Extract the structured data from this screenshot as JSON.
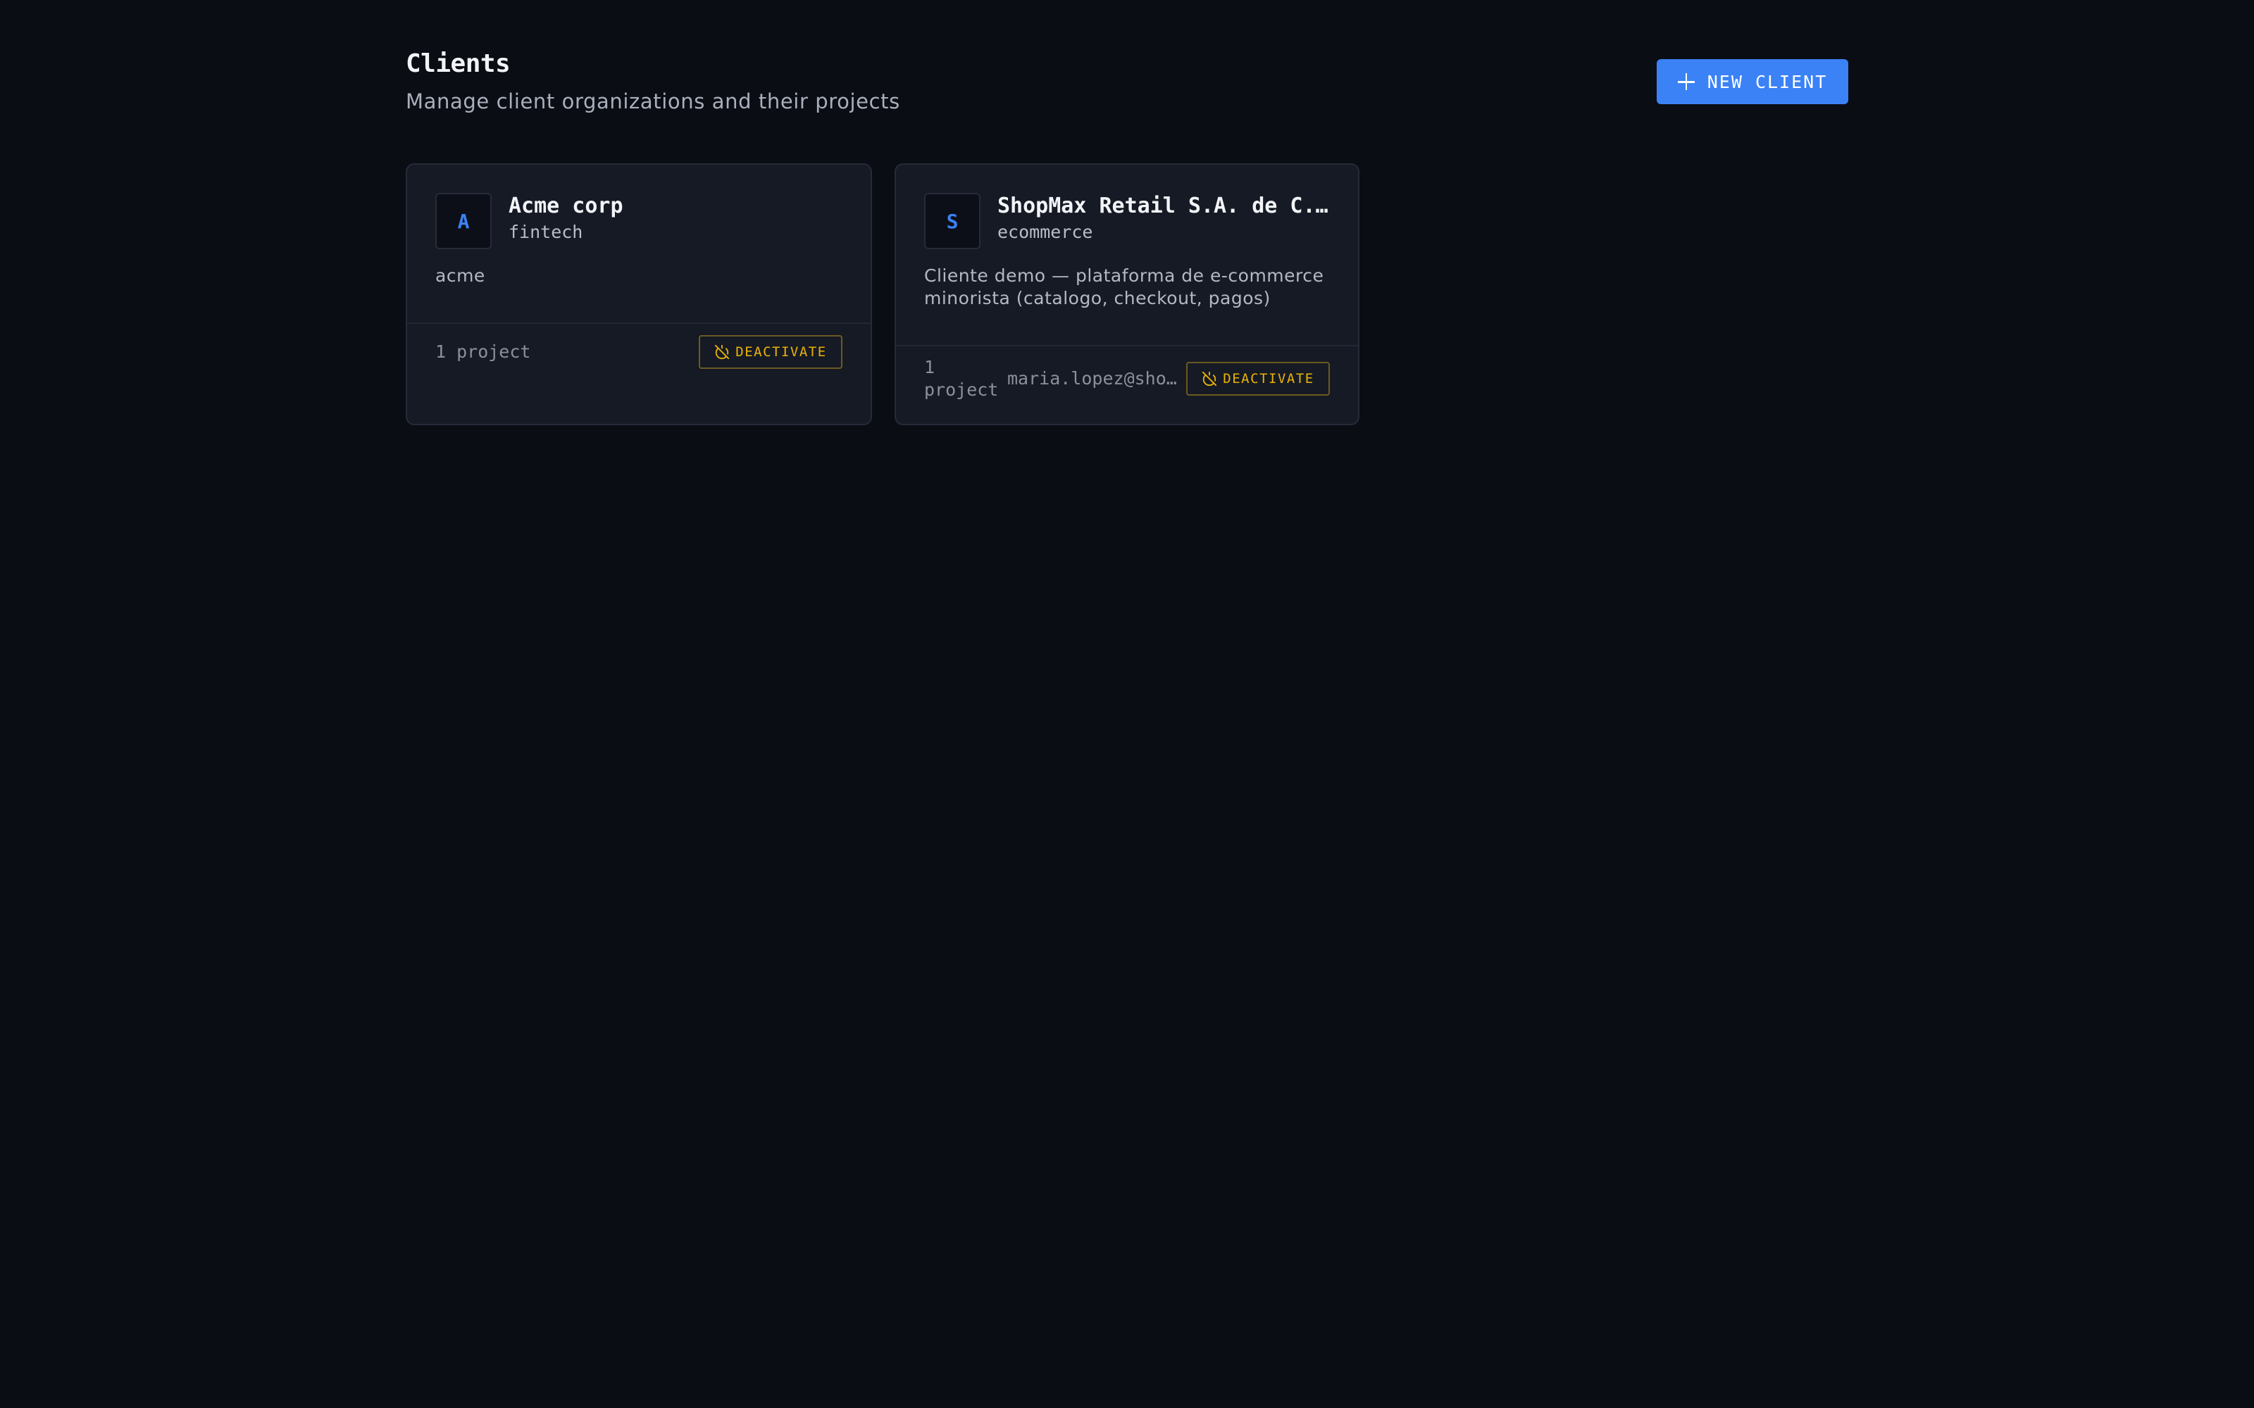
{
  "header": {
    "title": "Clients",
    "subtitle": "Manage client organizations and their projects",
    "new_client_label": "NEW CLIENT"
  },
  "clients": [
    {
      "avatar": "A",
      "name": "Acme corp",
      "industry": "fintech",
      "description": "acme",
      "projects": "1 project",
      "contact": "",
      "deactivate_label": "DEACTIVATE"
    },
    {
      "avatar": "S",
      "name": "ShopMax Retail S.A. de C.V.",
      "industry": "ecommerce",
      "description": "Cliente demo — plataforma de e-commerce minorista (catalogo, checkout, pagos)",
      "projects": "1 project",
      "contact": "maria.lopez@shopmax.mx",
      "deactivate_label": "DEACTIVATE"
    }
  ],
  "colors": {
    "background": "#0a0d14",
    "card": "#161a24",
    "accent": "#3b82f6",
    "warning": "#eab308"
  },
  "icons": {
    "new_client": "plus-icon",
    "deactivate": "power-off-icon"
  }
}
